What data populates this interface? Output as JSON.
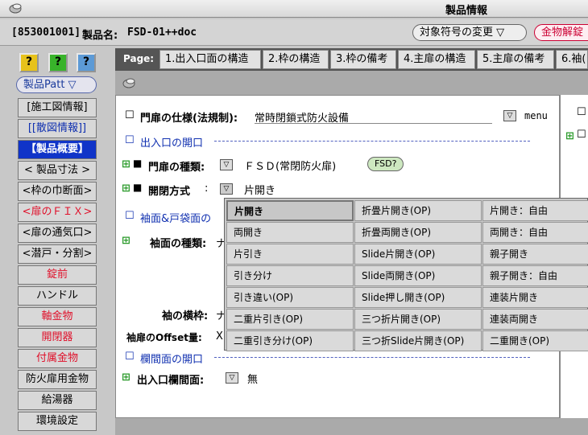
{
  "window": {
    "title": "製品情報"
  },
  "header": {
    "product_code": "[853001001]",
    "product_name_label": "製品名:",
    "product_name": "FSD-01++doc",
    "change_symbol_button": "対象符号の変更 ▽",
    "hardware_button": "金物解錠"
  },
  "sidebar": {
    "help_buttons": [
      "?",
      "?",
      "?"
    ],
    "pattern_dropdown": "製品Patt ▽",
    "items": [
      {
        "label": "[施工図情報]"
      },
      {
        "label": "[[散図情報]]"
      },
      {
        "label": "【製品概要】"
      },
      {
        "label": "< 製品寸法 >"
      },
      {
        "label": "<枠の巾断面>"
      },
      {
        "label": "<扉のＦＩＸ>"
      },
      {
        "label": "<扉の通気口>"
      },
      {
        "label": "<潜戸・分割>"
      },
      {
        "label": "錠前"
      },
      {
        "label": "ハンドル"
      },
      {
        "label": "軸金物"
      },
      {
        "label": "開閉器"
      },
      {
        "label": "付属金物"
      },
      {
        "label": "防火扉用金物"
      },
      {
        "label": "給湯器"
      },
      {
        "label": "環境設定"
      }
    ]
  },
  "pages": {
    "label": "Page:",
    "tabs": [
      "1.出入口面の構造",
      "2.枠の構造",
      "3.枠の備考",
      "4.主扉の構造",
      "5.主扉の備考",
      "6.袖("
    ]
  },
  "form": {
    "spec_label": "門扉の仕様(法規制):",
    "spec_value": "常時閉鎖式防火設備",
    "menu_label": "menu",
    "section1": "出入口の開口",
    "door_type_label": "門扉の種類:",
    "door_type_value": "ＦＳＤ(常閉防火扉)",
    "fsd_badge": "FSD?",
    "open_method_label": "開閉方式",
    "open_method_colon": ":",
    "open_method_value": "片開き",
    "section2": "袖面&戸袋面の",
    "sleeve_type_label": "袖面の種類:",
    "sleeve_type_value": "ナ",
    "sleeve_width_label": "袖の横枠:",
    "sleeve_width_value": "ナ",
    "offset_label": "袖扉のOffset量:",
    "offset_value": "X",
    "section3": "欄間面の開口",
    "transom_label": "出入口欄間面:",
    "transom_value": "無"
  },
  "options": [
    [
      "片開き",
      "折畳片開き(OP)",
      "片開き：自由"
    ],
    [
      "両開き",
      "折畳両開き(OP)",
      "両開き：自由"
    ],
    [
      "片引き",
      "Slide片開き(OP)",
      "親子開き"
    ],
    [
      "引き分け",
      "Slide両開き(OP)",
      "親子開き：自由"
    ],
    [
      "引き違い(OP)",
      "Slide押し開き(OP)",
      "連装片開き"
    ],
    [
      "二重片引き(OP)",
      "三つ折片開き(OP)",
      "連装両開き"
    ],
    [
      "二重引き分け(OP)",
      "三つ折Slide片開き(OP)",
      "二重開き(OP)"
    ]
  ]
}
